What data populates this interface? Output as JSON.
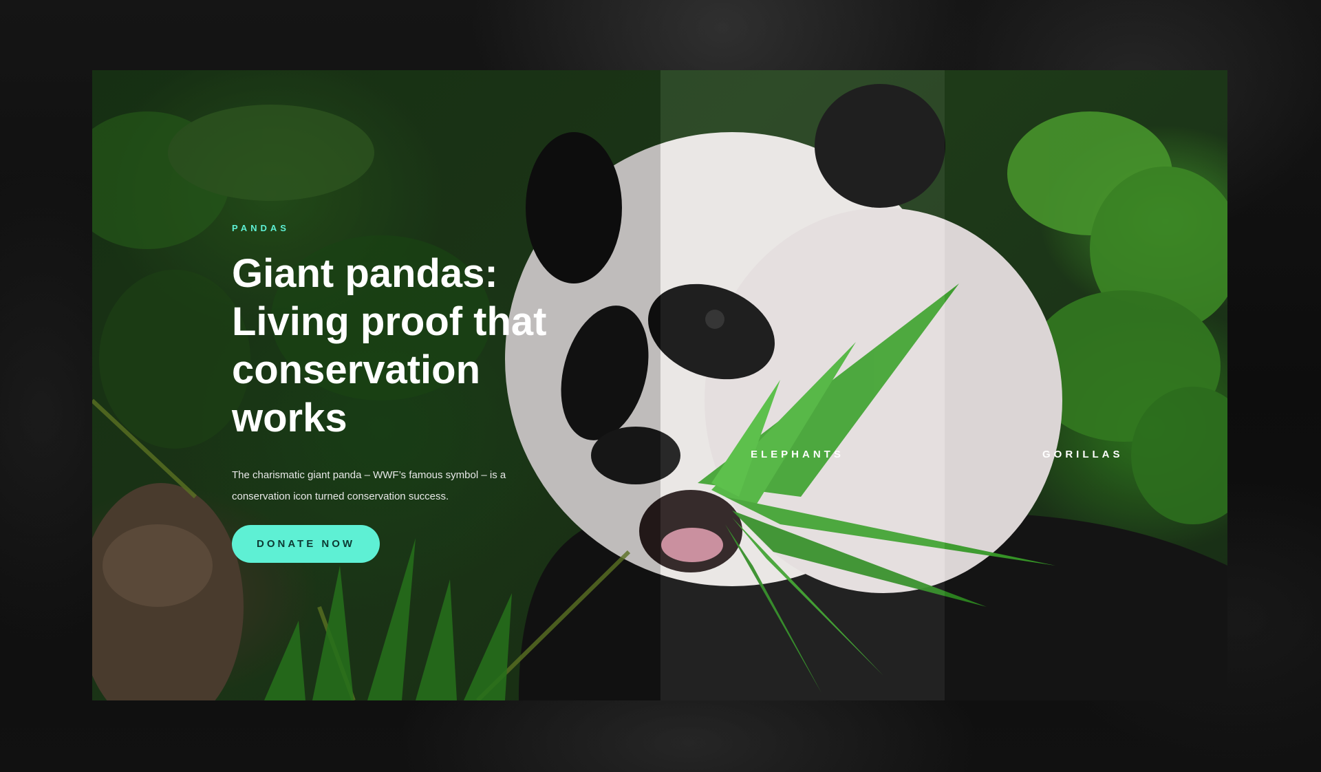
{
  "hero": {
    "eyebrow": "PANDAS",
    "headline": "Giant pandas: Living proof that conservation works",
    "description": "The charismatic giant panda – WWF’s famous symbol – is a conservation icon turned conservation success.",
    "donate_label": "DONATE NOW"
  },
  "tabs": [
    {
      "label": "ELEPHANTS"
    },
    {
      "label": "GORILLAS"
    }
  ],
  "colors": {
    "accent": "#5ef0d4",
    "accent_text": "#0d3a33",
    "background": "#0b0b0b"
  }
}
